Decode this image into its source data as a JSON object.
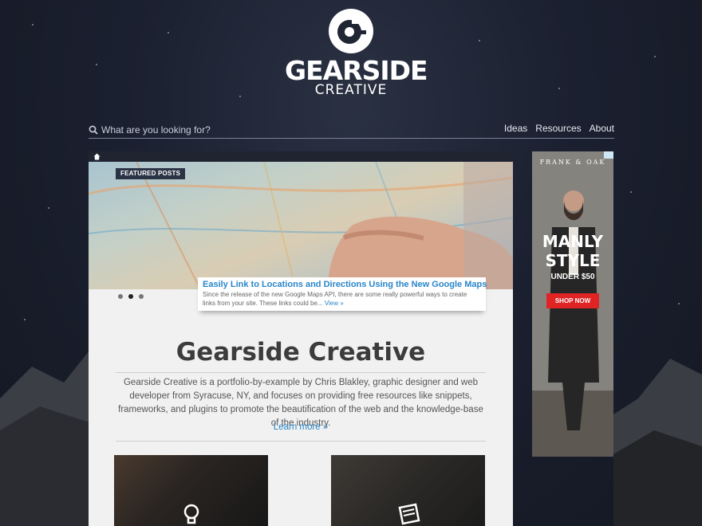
{
  "logo": {
    "title": "GEARSIDE",
    "subtitle": "CREATIVE"
  },
  "search": {
    "placeholder": "What are you looking for?"
  },
  "nav": {
    "items": [
      "Ideas",
      "Resources",
      "About"
    ]
  },
  "featured": {
    "badge": "FEATURED POSTS",
    "title": "Easily Link to Locations and Directions Using the New Google Maps",
    "excerpt": "Since the release of the new Google Maps API, there are some really powerful ways to create links from your site. These links could be...",
    "view_link": "View »",
    "slides_count": 3,
    "active_slide": 2
  },
  "intro": {
    "heading": "Gearside Creative",
    "text": "Gearside Creative is a portfolio-by-example by Chris Blakley, graphic designer and web developer from Syracuse, NY, and focuses on providing free resources like snippets, frameworks, and plugins to promote the beautification of the web and the knowledge-base of the industry.",
    "learn_more": "Learn more »"
  },
  "ad": {
    "brand": "FRANK & OAK",
    "title_line1": "MANLY",
    "title_line2": "STYLE",
    "price": "UNDER $50",
    "cta": "SHOP NOW"
  },
  "colors": {
    "link": "#2a86c9",
    "badge_bg": "#2b3346",
    "ad_cta": "#e02424"
  }
}
